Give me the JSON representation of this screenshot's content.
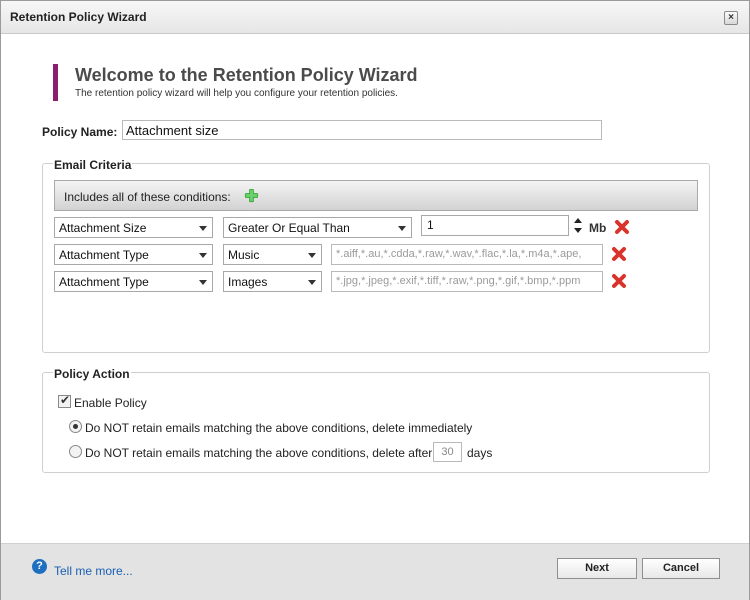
{
  "window": {
    "title": "Retention Policy Wizard",
    "close_glyph": "×"
  },
  "header": {
    "title": "Welcome to the Retention Policy Wizard",
    "subtitle": "The retention policy wizard will help you configure your retention policies."
  },
  "policy": {
    "label": "Policy Name:",
    "value": "Attachment size"
  },
  "criteria": {
    "legend": "Email Criteria",
    "header": "Includes all of these conditions:",
    "rows": [
      {
        "field": "Attachment Size",
        "operator": "Greater Or Equal Than",
        "value": "1",
        "unit": "Mb"
      },
      {
        "field": "Attachment Type",
        "operator": "Music",
        "value": "*.aiff,*.au,*.cdda,*.raw,*.wav,*.flac,*.la,*.m4a,*.ape,"
      },
      {
        "field": "Attachment Type",
        "operator": "Images",
        "value": "*.jpg,*.jpeg,*.exif,*.tiff,*.raw,*.png,*.gif,*.bmp,*.ppm"
      }
    ]
  },
  "action": {
    "legend": "Policy Action",
    "enable_label": "Enable Policy",
    "enabled": true,
    "option_immediate": "Do NOT retain emails matching the above conditions, delete immediately",
    "option_after": "Do NOT retain emails matching the above conditions, delete after",
    "selected_option": "immediate",
    "days_value": "30",
    "days_label": "days"
  },
  "footer": {
    "help_icon": "question-icon",
    "help_link": "Tell me more...",
    "next_label": "Next",
    "cancel_label": "Cancel"
  },
  "colors": {
    "accent": "#8b1f6e",
    "link": "#1a5fb4",
    "add_green": "#3aa63a",
    "delete_red": "#d9342b"
  }
}
